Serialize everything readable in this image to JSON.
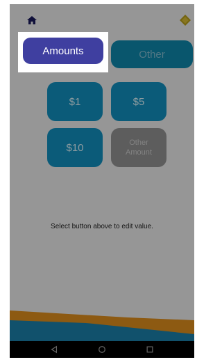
{
  "header": {
    "home_icon": "home-icon",
    "badge_icon": "diamond-icon"
  },
  "tabs": {
    "amounts_label": "Amounts",
    "other_label": "Other"
  },
  "amounts": [
    {
      "label": "$1"
    },
    {
      "label": "$5"
    },
    {
      "label": "$10"
    },
    {
      "label": "Other Amount"
    }
  ],
  "hint": "Select button above to edit value.",
  "navbar": {
    "back_icon": "back-triangle-icon",
    "home_icon": "home-circle-icon",
    "recents_icon": "recents-square-icon"
  },
  "colors": {
    "accent_blue": "#118cbb",
    "selected_tab": "#3f3fa0",
    "wave_orange": "#d98a1c",
    "wave_teal": "#1b7da6"
  }
}
